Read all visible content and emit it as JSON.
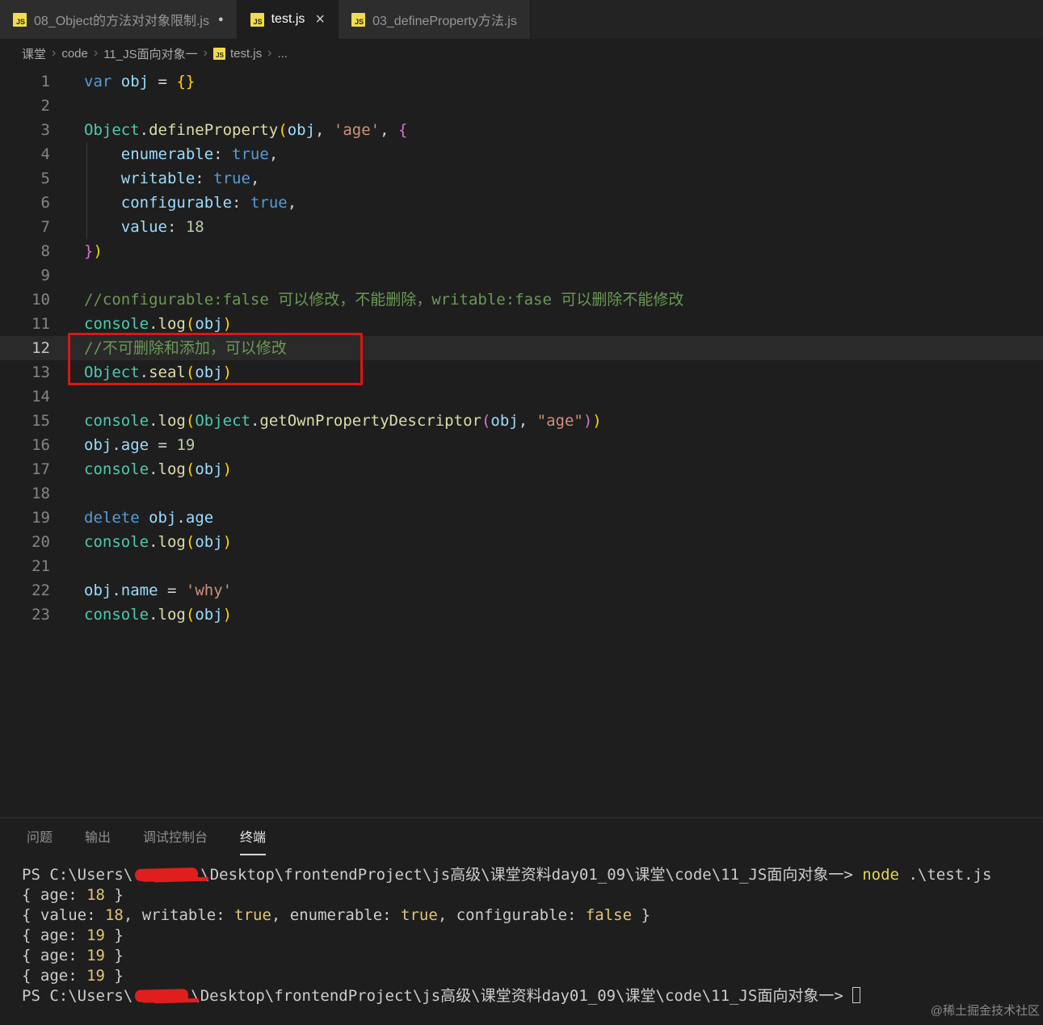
{
  "window": {
    "tabs": [
      {
        "label": "08_Object的方法对对象限制.js",
        "modified": true,
        "active": false,
        "closable": false
      },
      {
        "label": "test.js",
        "modified": false,
        "active": true,
        "closable": true
      },
      {
        "label": "03_defineProperty方法.js",
        "modified": false,
        "active": false,
        "closable": false
      }
    ],
    "breadcrumb": [
      {
        "label": "课堂"
      },
      {
        "label": "code"
      },
      {
        "label": "11_JS面向对象一"
      },
      {
        "label": "test.js",
        "icon": "js"
      },
      {
        "label": "..."
      }
    ]
  },
  "editor": {
    "current_line": 12,
    "lines": [
      {
        "n": 1,
        "tokens": [
          {
            "c": "kw",
            "t": "var"
          },
          {
            "c": "pln",
            "t": " "
          },
          {
            "c": "var",
            "t": "obj"
          },
          {
            "c": "pln",
            "t": " = "
          },
          {
            "c": "b1",
            "t": "{}"
          }
        ]
      },
      {
        "n": 2,
        "tokens": []
      },
      {
        "n": 3,
        "tokens": [
          {
            "c": "cls",
            "t": "Object"
          },
          {
            "c": "pln",
            "t": "."
          },
          {
            "c": "fn",
            "t": "defineProperty"
          },
          {
            "c": "b1",
            "t": "("
          },
          {
            "c": "var",
            "t": "obj"
          },
          {
            "c": "pln",
            "t": ", "
          },
          {
            "c": "str",
            "t": "'age'"
          },
          {
            "c": "pln",
            "t": ", "
          },
          {
            "c": "b2",
            "t": "{"
          }
        ]
      },
      {
        "n": 4,
        "tokens": [
          {
            "c": "pln",
            "t": "    "
          },
          {
            "c": "var",
            "t": "enumerable"
          },
          {
            "c": "pln",
            "t": ": "
          },
          {
            "c": "kw",
            "t": "true"
          },
          {
            "c": "pln",
            "t": ","
          }
        ]
      },
      {
        "n": 5,
        "tokens": [
          {
            "c": "pln",
            "t": "    "
          },
          {
            "c": "var",
            "t": "writable"
          },
          {
            "c": "pln",
            "t": ": "
          },
          {
            "c": "kw",
            "t": "true"
          },
          {
            "c": "pln",
            "t": ","
          }
        ]
      },
      {
        "n": 6,
        "tokens": [
          {
            "c": "pln",
            "t": "    "
          },
          {
            "c": "var",
            "t": "configurable"
          },
          {
            "c": "pln",
            "t": ": "
          },
          {
            "c": "kw",
            "t": "true"
          },
          {
            "c": "pln",
            "t": ","
          }
        ]
      },
      {
        "n": 7,
        "tokens": [
          {
            "c": "pln",
            "t": "    "
          },
          {
            "c": "var",
            "t": "value"
          },
          {
            "c": "pln",
            "t": ": "
          },
          {
            "c": "num",
            "t": "18"
          }
        ]
      },
      {
        "n": 8,
        "tokens": [
          {
            "c": "b2",
            "t": "}"
          },
          {
            "c": "b1",
            "t": ")"
          }
        ]
      },
      {
        "n": 9,
        "tokens": []
      },
      {
        "n": 10,
        "tokens": [
          {
            "c": "com",
            "t": "//configurable:false 可以修改，不能删除，writable:fase 可以删除不能修改"
          }
        ]
      },
      {
        "n": 11,
        "tokens": [
          {
            "c": "cls",
            "t": "console"
          },
          {
            "c": "pln",
            "t": "."
          },
          {
            "c": "fn",
            "t": "log"
          },
          {
            "c": "b1",
            "t": "("
          },
          {
            "c": "var",
            "t": "obj"
          },
          {
            "c": "b1",
            "t": ")"
          }
        ]
      },
      {
        "n": 12,
        "tokens": [
          {
            "c": "com",
            "t": "//不可删除和添加，可以修改"
          }
        ]
      },
      {
        "n": 13,
        "tokens": [
          {
            "c": "cls",
            "t": "Object"
          },
          {
            "c": "pln",
            "t": "."
          },
          {
            "c": "fn",
            "t": "seal"
          },
          {
            "c": "b1",
            "t": "("
          },
          {
            "c": "var",
            "t": "obj"
          },
          {
            "c": "b1",
            "t": ")"
          }
        ]
      },
      {
        "n": 14,
        "tokens": []
      },
      {
        "n": 15,
        "tokens": [
          {
            "c": "cls",
            "t": "console"
          },
          {
            "c": "pln",
            "t": "."
          },
          {
            "c": "fn",
            "t": "log"
          },
          {
            "c": "b1",
            "t": "("
          },
          {
            "c": "cls",
            "t": "Object"
          },
          {
            "c": "pln",
            "t": "."
          },
          {
            "c": "fn",
            "t": "getOwnPropertyDescriptor"
          },
          {
            "c": "b2",
            "t": "("
          },
          {
            "c": "var",
            "t": "obj"
          },
          {
            "c": "pln",
            "t": ", "
          },
          {
            "c": "str",
            "t": "\"age\""
          },
          {
            "c": "b2",
            "t": ")"
          },
          {
            "c": "b1",
            "t": ")"
          }
        ]
      },
      {
        "n": 16,
        "tokens": [
          {
            "c": "var",
            "t": "obj"
          },
          {
            "c": "pln",
            "t": "."
          },
          {
            "c": "var",
            "t": "age"
          },
          {
            "c": "pln",
            "t": " = "
          },
          {
            "c": "num",
            "t": "19"
          }
        ]
      },
      {
        "n": 17,
        "tokens": [
          {
            "c": "cls",
            "t": "console"
          },
          {
            "c": "pln",
            "t": "."
          },
          {
            "c": "fn",
            "t": "log"
          },
          {
            "c": "b1",
            "t": "("
          },
          {
            "c": "var",
            "t": "obj"
          },
          {
            "c": "b1",
            "t": ")"
          }
        ]
      },
      {
        "n": 18,
        "tokens": []
      },
      {
        "n": 19,
        "tokens": [
          {
            "c": "kw",
            "t": "delete"
          },
          {
            "c": "pln",
            "t": " "
          },
          {
            "c": "var",
            "t": "obj"
          },
          {
            "c": "pln",
            "t": "."
          },
          {
            "c": "var",
            "t": "age"
          }
        ]
      },
      {
        "n": 20,
        "tokens": [
          {
            "c": "cls",
            "t": "console"
          },
          {
            "c": "pln",
            "t": "."
          },
          {
            "c": "fn",
            "t": "log"
          },
          {
            "c": "b1",
            "t": "("
          },
          {
            "c": "var",
            "t": "obj"
          },
          {
            "c": "b1",
            "t": ")"
          }
        ]
      },
      {
        "n": 21,
        "tokens": []
      },
      {
        "n": 22,
        "tokens": [
          {
            "c": "var",
            "t": "obj"
          },
          {
            "c": "pln",
            "t": "."
          },
          {
            "c": "var",
            "t": "name"
          },
          {
            "c": "pln",
            "t": " = "
          },
          {
            "c": "str",
            "t": "'why'"
          }
        ]
      },
      {
        "n": 23,
        "tokens": [
          {
            "c": "cls",
            "t": "console"
          },
          {
            "c": "pln",
            "t": "."
          },
          {
            "c": "fn",
            "t": "log"
          },
          {
            "c": "b1",
            "t": "("
          },
          {
            "c": "var",
            "t": "obj"
          },
          {
            "c": "b1",
            "t": ")"
          }
        ]
      }
    ]
  },
  "panel": {
    "tabs": [
      {
        "label": "问题",
        "active": false
      },
      {
        "label": "输出",
        "active": false
      },
      {
        "label": "调试控制台",
        "active": false
      },
      {
        "label": "终端",
        "active": true
      }
    ]
  },
  "terminal": {
    "lines": [
      {
        "tokens": [
          {
            "c": "pln",
            "t": "PS C:\\Users\\"
          },
          {
            "c": "redact",
            "w": 78
          },
          {
            "c": "pln",
            "t": "\\Desktop\\frontendProject\\js高级\\课堂资料day01_09\\课堂\\code\\11_JS面向对象一> "
          },
          {
            "c": "cmd",
            "t": "node"
          },
          {
            "c": "pln",
            "t": " .\\test.js"
          }
        ]
      },
      {
        "tokens": [
          {
            "c": "pln",
            "t": "{ age: "
          },
          {
            "c": "num",
            "t": "18"
          },
          {
            "c": "pln",
            "t": " }"
          }
        ]
      },
      {
        "tokens": [
          {
            "c": "pln",
            "t": "{ value: "
          },
          {
            "c": "num",
            "t": "18"
          },
          {
            "c": "pln",
            "t": ", writable: "
          },
          {
            "c": "bool",
            "t": "true"
          },
          {
            "c": "pln",
            "t": ", enumerable: "
          },
          {
            "c": "bool",
            "t": "true"
          },
          {
            "c": "pln",
            "t": ", configurable: "
          },
          {
            "c": "bool",
            "t": "false"
          },
          {
            "c": "pln",
            "t": " }"
          }
        ]
      },
      {
        "tokens": [
          {
            "c": "pln",
            "t": "{ age: "
          },
          {
            "c": "num",
            "t": "19"
          },
          {
            "c": "pln",
            "t": " }"
          }
        ]
      },
      {
        "tokens": [
          {
            "c": "pln",
            "t": "{ age: "
          },
          {
            "c": "num",
            "t": "19"
          },
          {
            "c": "pln",
            "t": " }"
          }
        ]
      },
      {
        "tokens": [
          {
            "c": "pln",
            "t": "{ age: "
          },
          {
            "c": "num",
            "t": "19"
          },
          {
            "c": "pln",
            "t": " }"
          }
        ]
      },
      {
        "tokens": [
          {
            "c": "pln",
            "t": "PS C:\\Users\\"
          },
          {
            "c": "redact",
            "w": 66
          },
          {
            "c": "pln",
            "t": "\\Desktop\\frontendProject\\js高级\\课堂资料day01_09\\课堂\\code\\11_JS面向对象一> "
          },
          {
            "c": "cursor"
          }
        ]
      }
    ]
  },
  "watermark": "@稀土掘金技术社区",
  "colors": {
    "editor_bg": "#1e1e1e",
    "tabbar_bg": "#232323",
    "inactive_tab_bg": "#2d2d2d",
    "keyword": "#569cd6",
    "variable": "#9cdcfe",
    "function": "#dcdcaa",
    "class": "#4ec9b0",
    "string": "#ce9178",
    "number": "#b5cea8",
    "comment": "#6a9955",
    "bracket_level1": "#ffd700",
    "bracket_level2": "#da70d6",
    "annotation_red": "#e01414",
    "terminal_yellow": "#e0c578",
    "js_icon_yellow": "#f0dc4e"
  }
}
